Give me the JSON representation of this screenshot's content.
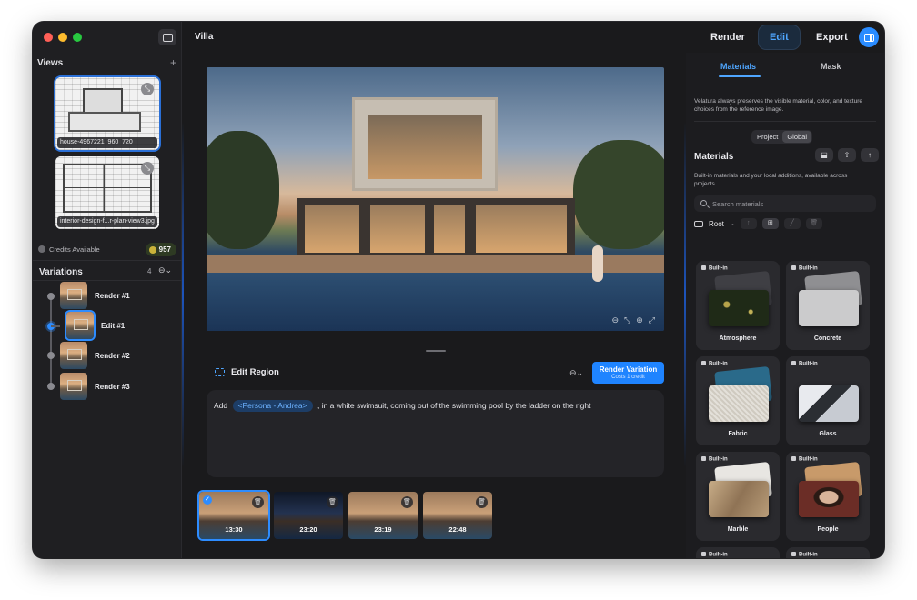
{
  "window": {
    "title": "Villa",
    "traffic_colors": [
      "#ff5f57",
      "#febc2e",
      "#28c840"
    ]
  },
  "header": {
    "tabs": [
      {
        "label": "Render",
        "active": false
      },
      {
        "label": "Edit",
        "active": true
      },
      {
        "label": "Export",
        "active": false
      }
    ]
  },
  "sidebar": {
    "views_title": "Views",
    "add_glyph": "+",
    "views": [
      {
        "caption": "house-4967221_960_720",
        "selected": true
      },
      {
        "caption": "interior-design-f...r-plan-view3.jpg",
        "selected": false
      }
    ],
    "credits_label": "Credits Available",
    "credits_value": "957",
    "variations_title": "Variations",
    "variations_count": "4",
    "variations": [
      {
        "label": "Render #1",
        "active": false
      },
      {
        "label": "Edit #1",
        "active": true
      },
      {
        "label": "Render #2",
        "active": false
      },
      {
        "label": "Render #3",
        "active": false
      }
    ]
  },
  "editor": {
    "edit_region_label": "Edit Region",
    "render_button": {
      "label": "Render Variation",
      "sublabel": "Costs 1 credit"
    },
    "prompt": {
      "before": "Add",
      "chip": "<Persona - Andrea>",
      "after": ", in a white swimsuit, coming out of the swimming pool by the ladder on the right"
    },
    "history": [
      {
        "time": "13:30",
        "selected": true,
        "night": false
      },
      {
        "time": "23:20",
        "selected": false,
        "night": true
      },
      {
        "time": "23:19",
        "selected": false,
        "night": false
      },
      {
        "time": "22:48",
        "selected": false,
        "night": false
      }
    ]
  },
  "right_panel": {
    "tabs": [
      {
        "label": "Materials",
        "active": true
      },
      {
        "label": "Mask",
        "active": false
      }
    ],
    "note": "Velatura always preserves the visible material, color, and texture choices from the reference image.",
    "scope_options": [
      "Project",
      "Global"
    ],
    "scope_selected": "Global",
    "materials_title": "Materials",
    "materials_note": "Built-in materials and your local additions, available across projects.",
    "search_placeholder": "Search materials",
    "root_label": "Root",
    "builtin_label": "Built-in",
    "materials": [
      {
        "name": "Atmosphere",
        "color": "#2d3a1e"
      },
      {
        "name": "Concrete",
        "color": "#c9c9c9"
      },
      {
        "name": "Fabric",
        "color": "#d9d6cf"
      },
      {
        "name": "Glass",
        "color": "#9aa0a8"
      },
      {
        "name": "Marble",
        "color": "#b89c78"
      },
      {
        "name": "People",
        "color": "#6b2d26"
      },
      {
        "name": "",
        "color": "#8a7a66"
      },
      {
        "name": "",
        "color": "#6a7a5a"
      }
    ]
  },
  "accent": "#1f84ff"
}
